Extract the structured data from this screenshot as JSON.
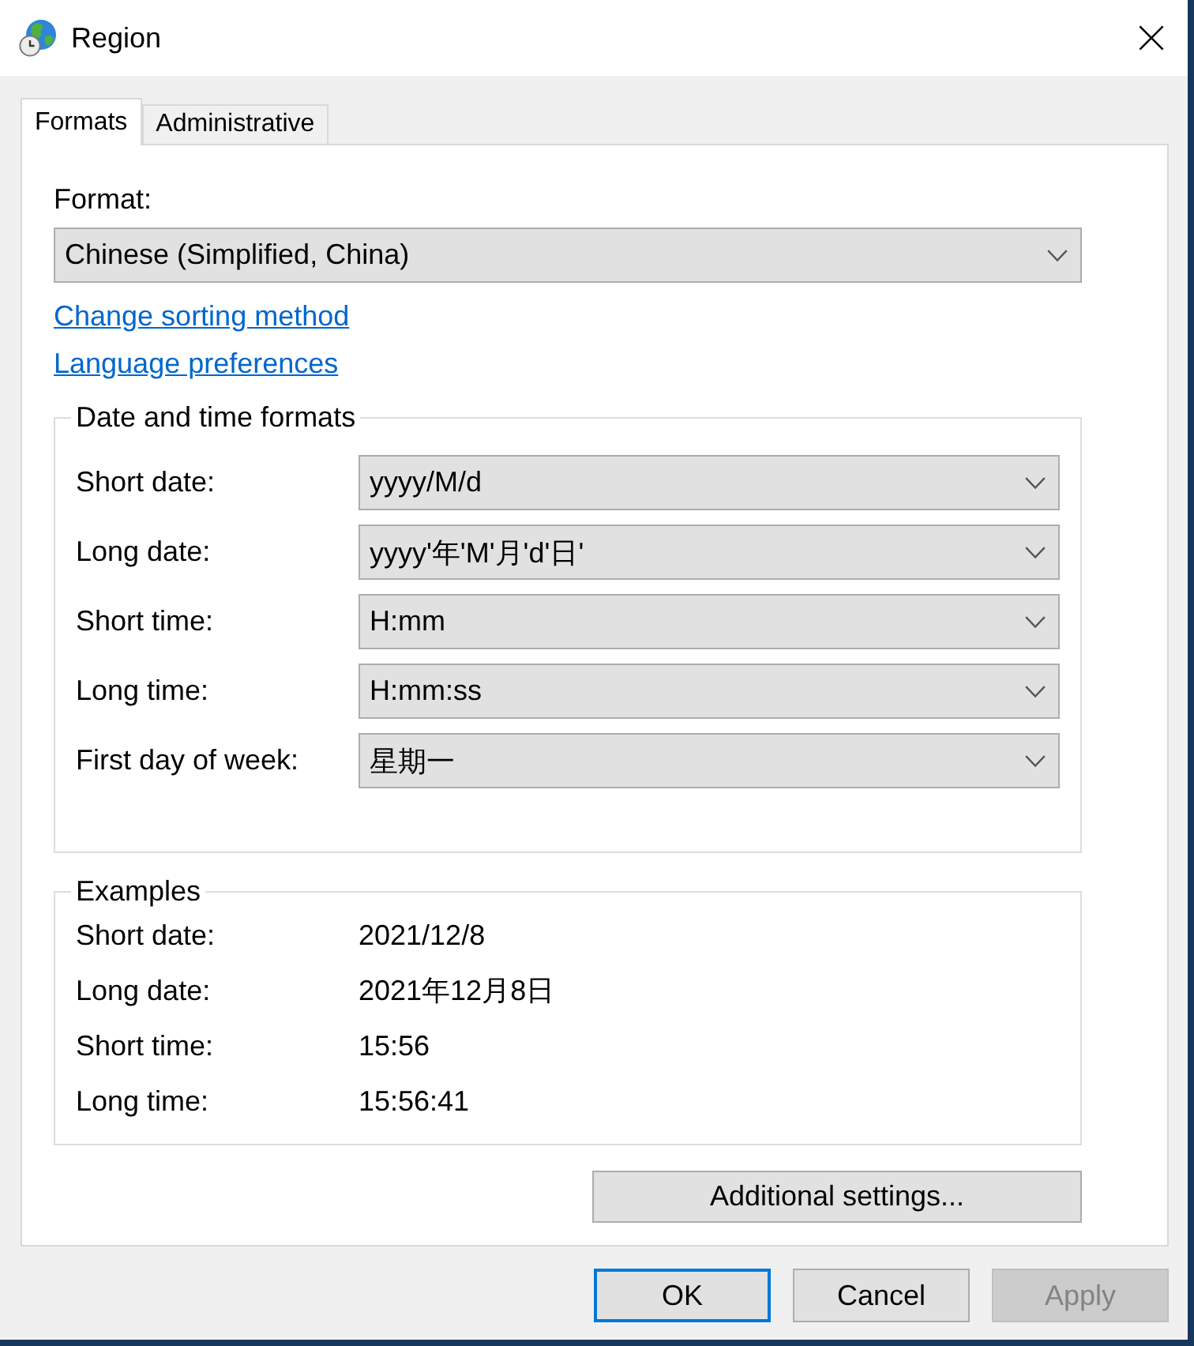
{
  "window": {
    "title": "Region"
  },
  "tabs": [
    {
      "label": "Formats",
      "selected": true
    },
    {
      "label": "Administrative",
      "selected": false
    }
  ],
  "format": {
    "label": "Format:",
    "value": "Chinese (Simplified, China)"
  },
  "links": [
    "Change sorting method",
    "Language preferences"
  ],
  "date_and_time_formats": {
    "title": "Date and time formats",
    "rows": [
      {
        "label": "Short date:",
        "value": "yyyy/M/d"
      },
      {
        "label": "Long date:",
        "value": "yyyy'年'M'月'd'日'"
      },
      {
        "label": "Short time:",
        "value": "H:mm"
      },
      {
        "label": "Long time:",
        "value": "H:mm:ss"
      },
      {
        "label": "First day of week:",
        "value": "星期一"
      }
    ]
  },
  "examples": {
    "title": "Examples",
    "rows": [
      {
        "label": "Short date:",
        "value": "2021/12/8"
      },
      {
        "label": "Long date:",
        "value": "2021年12月8日"
      },
      {
        "label": "Short time:",
        "value": "15:56"
      },
      {
        "label": "Long time:",
        "value": "15:56:41"
      }
    ]
  },
  "additional_settings_button": {
    "label": "Additional settings..."
  },
  "buttons": [
    {
      "label": "OK",
      "default": true,
      "disabled": false
    },
    {
      "label": "Cancel",
      "default": false,
      "disabled": false
    },
    {
      "label": "Apply",
      "default": false,
      "disabled": true
    }
  ]
}
